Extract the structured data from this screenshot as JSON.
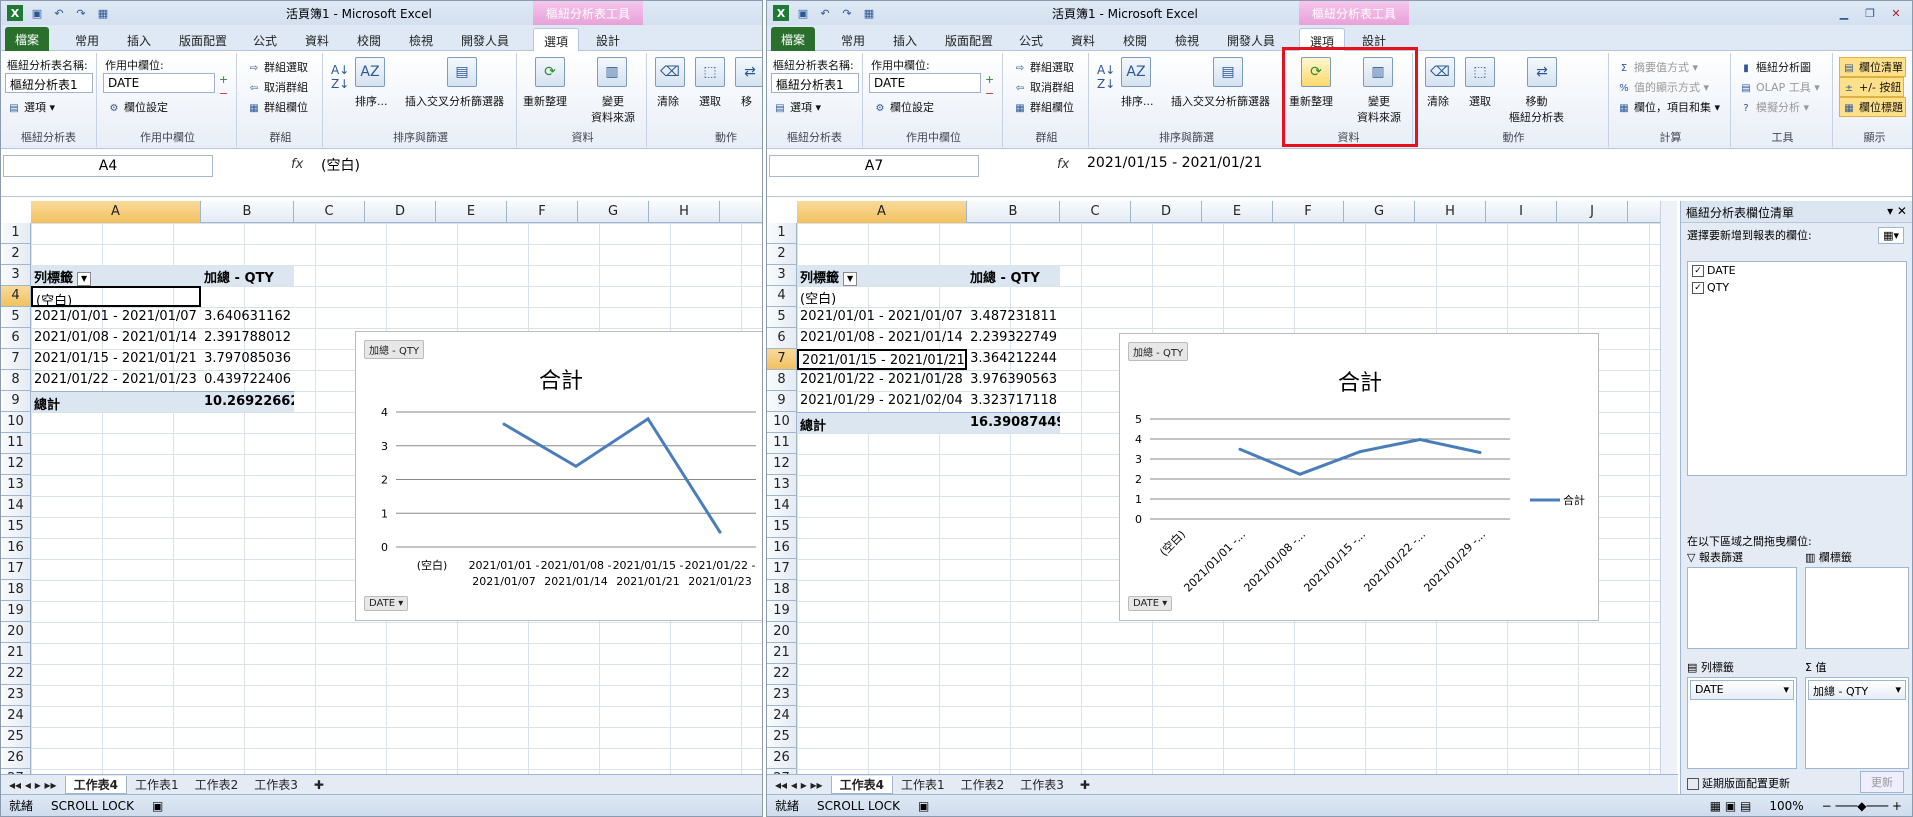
{
  "left": {
    "title": "活頁簿1 - Microsoft Excel",
    "ctx_tab": "樞紐分析表工具",
    "tabs": [
      "檔案",
      "常用",
      "插入",
      "版面配置",
      "公式",
      "資料",
      "校閱",
      "檢視",
      "開發人員",
      "選項",
      "設計"
    ],
    "ribbon": {
      "pt_name_label": "樞紐分析表名稱:",
      "pt_name_value": "樞紐分析表1",
      "options_label": "選項",
      "group_pt": "樞紐分析表",
      "active_field_label": "作用中欄位:",
      "active_field_value": "DATE",
      "field_settings": "欄位設定",
      "group_active": "作用中欄位",
      "group_sel": "群組選取",
      "ungroup": "取消群組",
      "group_field": "群組欄位",
      "group_group": "群組",
      "sort": "排序...",
      "slicer": "插入交叉分析篩選器",
      "group_sort": "排序與篩選",
      "refresh": "重新整理",
      "change_source": "變更\n資料來源",
      "group_data": "資料",
      "clear": "清除",
      "select": "選取",
      "move": "移",
      "group_actions": "動作"
    },
    "namebox": "A4",
    "formula": "(空白)",
    "columns": [
      "A",
      "B",
      "C",
      "D",
      "E",
      "F",
      "G",
      "H"
    ],
    "rows": [
      "1",
      "2",
      "3",
      "4",
      "5",
      "6",
      "7",
      "8",
      "9",
      "10",
      "11",
      "12",
      "13",
      "14",
      "15",
      "16",
      "17",
      "18",
      "19",
      "20",
      "21",
      "22",
      "23",
      "24",
      "25",
      "26",
      "27"
    ],
    "pivot": {
      "row_label": "列標籤",
      "sum_label": "加總 - QTY",
      "items": [
        {
          "label": "(空白)",
          "value": ""
        },
        {
          "label": "2021/01/01 - 2021/01/07",
          "value": "3.640631162"
        },
        {
          "label": "2021/01/08 - 2021/01/14",
          "value": "2.391788012"
        },
        {
          "label": "2021/01/15 - 2021/01/21",
          "value": "3.797085036"
        },
        {
          "label": "2021/01/22 - 2021/01/23",
          "value": "0.439722406"
        }
      ],
      "total_label": "總計",
      "total_value": "10.26922662"
    },
    "chart": {
      "field_button": "加總 - QTY",
      "axis_button": "DATE",
      "title": "合計"
    },
    "sheets": [
      "工作表4",
      "工作表1",
      "工作表2",
      "工作表3"
    ],
    "status": [
      "就緒",
      "SCROLL LOCK"
    ]
  },
  "right": {
    "title": "活頁簿1 - Microsoft Excel",
    "ctx_tab": "樞紐分析表工具",
    "tabs": [
      "檔案",
      "常用",
      "插入",
      "版面配置",
      "公式",
      "資料",
      "校閱",
      "檢視",
      "開發人員",
      "選項",
      "設計"
    ],
    "ribbon": {
      "pt_name_label": "樞紐分析表名稱:",
      "pt_name_value": "樞紐分析表1",
      "options_label": "選項",
      "group_pt": "樞紐分析表",
      "active_field_label": "作用中欄位:",
      "active_field_value": "DATE",
      "field_settings": "欄位設定",
      "group_active": "作用中欄位",
      "group_sel": "群組選取",
      "ungroup": "取消群組",
      "group_field": "群組欄位",
      "group_group": "群組",
      "sort": "排序...",
      "slicer": "插入交叉分析篩選器",
      "group_sort": "排序與篩選",
      "refresh": "重新整理",
      "change_source": "變更\n資料來源",
      "group_data": "資料",
      "clear": "清除",
      "select": "選取",
      "move": "移動\n樞紐分析表",
      "group_actions": "動作",
      "calc1": "摘要值方式",
      "calc2": "值的顯示方式",
      "calc3": "欄位，項目和集",
      "group_calc": "計算",
      "tool1": "樞紐分析圖",
      "tool2": "OLAP 工具",
      "tool3": "模擬分析",
      "group_tools": "工具",
      "show1": "欄位清單",
      "show2": "+/- 按鈕",
      "show3": "欄位標題",
      "group_show": "顯示"
    },
    "namebox": "A7",
    "formula": "2021/01/15 - 2021/01/21",
    "columns": [
      "A",
      "B",
      "C",
      "D",
      "E",
      "F",
      "G",
      "H",
      "I",
      "J"
    ],
    "rows": [
      "1",
      "2",
      "3",
      "4",
      "5",
      "6",
      "7",
      "8",
      "9",
      "10",
      "11",
      "12",
      "13",
      "14",
      "15",
      "16",
      "17",
      "18",
      "19",
      "20",
      "21",
      "22",
      "23",
      "24",
      "25",
      "26",
      "27"
    ],
    "pivot": {
      "row_label": "列標籤",
      "sum_label": "加總 - QTY",
      "items": [
        {
          "label": "(空白)",
          "value": ""
        },
        {
          "label": "2021/01/01 - 2021/01/07",
          "value": "3.487231811"
        },
        {
          "label": "2021/01/08 - 2021/01/14",
          "value": "2.239322749"
        },
        {
          "label": "2021/01/15 - 2021/01/21",
          "value": "3.364212244"
        },
        {
          "label": "2021/01/22 - 2021/01/28",
          "value": "3.976390563"
        },
        {
          "label": "2021/01/29 - 2021/02/04",
          "value": "3.323717118"
        }
      ],
      "total_label": "總計",
      "total_value": "16.39087449"
    },
    "chart": {
      "field_button": "加總 - QTY",
      "axis_button": "DATE",
      "title": "合計",
      "legend": "合計"
    },
    "field_list": {
      "title": "樞紐分析表欄位清單",
      "choose_label": "選擇要新增到報表的欄位:",
      "fields": [
        "DATE",
        "QTY"
      ],
      "drag_label": "在以下區域之間拖曳欄位:",
      "report_filter": "報表篩選",
      "column_labels": "欄標籤",
      "row_labels": "列標籤",
      "values": "值",
      "row_field": "DATE",
      "value_field": "加總 - QTY",
      "defer_label": "延期版面配置更新",
      "update_button": "更新"
    },
    "sheets": [
      "工作表4",
      "工作表1",
      "工作表2",
      "工作表3"
    ],
    "status": [
      "就緒",
      "SCROLL LOCK"
    ],
    "zoom": "100%"
  },
  "chart_data": [
    {
      "type": "line",
      "title": "合計",
      "categories": [
        "(空白)",
        "2021/01/01 - 2021/01/07",
        "2021/01/08 - 2021/01/14",
        "2021/01/15 - 2021/01/21",
        "2021/01/22 - 2021/01/23"
      ],
      "values": [
        null,
        3.640631162,
        2.391788012,
        3.797085036,
        0.439722406
      ],
      "ylim": [
        0,
        4
      ],
      "yticks": [
        0,
        1,
        2,
        3,
        4
      ],
      "color": "#4a7ebb",
      "grid": true
    },
    {
      "type": "line",
      "title": "合計",
      "categories": [
        "(空白)",
        "2021/01/01 -...",
        "2021/01/08 -...",
        "2021/01/15 -...",
        "2021/01/22 -...",
        "2021/01/29 -..."
      ],
      "series": [
        {
          "name": "合計",
          "values": [
            null,
            3.487231811,
            2.239322749,
            3.364212244,
            3.976390563,
            3.323717118
          ]
        }
      ],
      "ylim": [
        0,
        5
      ],
      "yticks": [
        0,
        1,
        2,
        3,
        4,
        5
      ],
      "color": "#4a7ebb",
      "grid": true,
      "legend": "right"
    }
  ]
}
